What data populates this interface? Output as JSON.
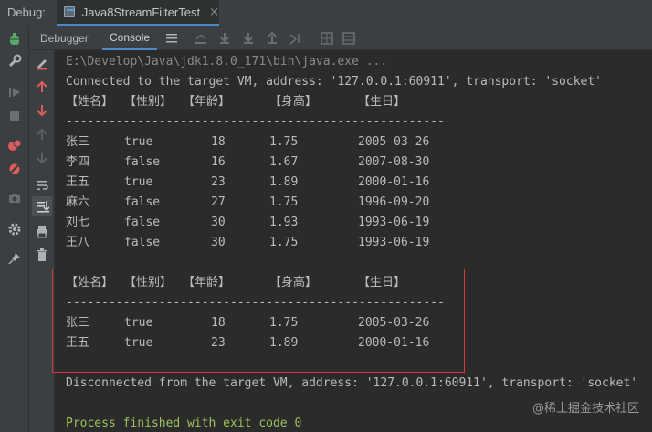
{
  "window": {
    "debug_label": "Debug:",
    "tab_title": "Java8StreamFilterTest",
    "tab_close": "×"
  },
  "toolbar": {
    "debugger_tab": "Debugger",
    "console_tab": "Console"
  },
  "console": {
    "command_line": "E:\\Develop\\Java\\jdk1.8.0_171\\bin\\java.exe ...",
    "connected_line": "Connected to the target VM, address: '127.0.0.1:60911', transport: 'socket'",
    "headers": [
      "【姓名】",
      "【性别】",
      "【年龄】",
      "【身高】",
      "【生日】"
    ],
    "separator": "-----------------------------------------------------",
    "table1": [
      [
        "张三",
        "true",
        "18",
        "1.75",
        "2005-03-26"
      ],
      [
        "李四",
        "false",
        "16",
        "1.67",
        "2007-08-30"
      ],
      [
        "王五",
        "true",
        "23",
        "1.89",
        "2000-01-16"
      ],
      [
        "麻六",
        "false",
        "27",
        "1.75",
        "1996-09-20"
      ],
      [
        "刘七",
        "false",
        "30",
        "1.93",
        "1993-06-19"
      ],
      [
        "王八",
        "false",
        "30",
        "1.75",
        "1993-06-19"
      ]
    ],
    "table2": [
      [
        "张三",
        "true",
        "18",
        "1.75",
        "2005-03-26"
      ],
      [
        "王五",
        "true",
        "23",
        "1.89",
        "2000-01-16"
      ]
    ],
    "disconnected_line": "Disconnected from the target VM, address: '127.0.0.1:60911', transport: 'socket'",
    "exit_line": "Process finished with exit code 0"
  },
  "watermark": "@稀土掘金技术社区",
  "colors": {
    "background": "#2b2b2b",
    "panel": "#3c3f41",
    "accent": "#4a88c7",
    "highlight_box": "#d9363e",
    "exit_green": "#9ec15b"
  }
}
